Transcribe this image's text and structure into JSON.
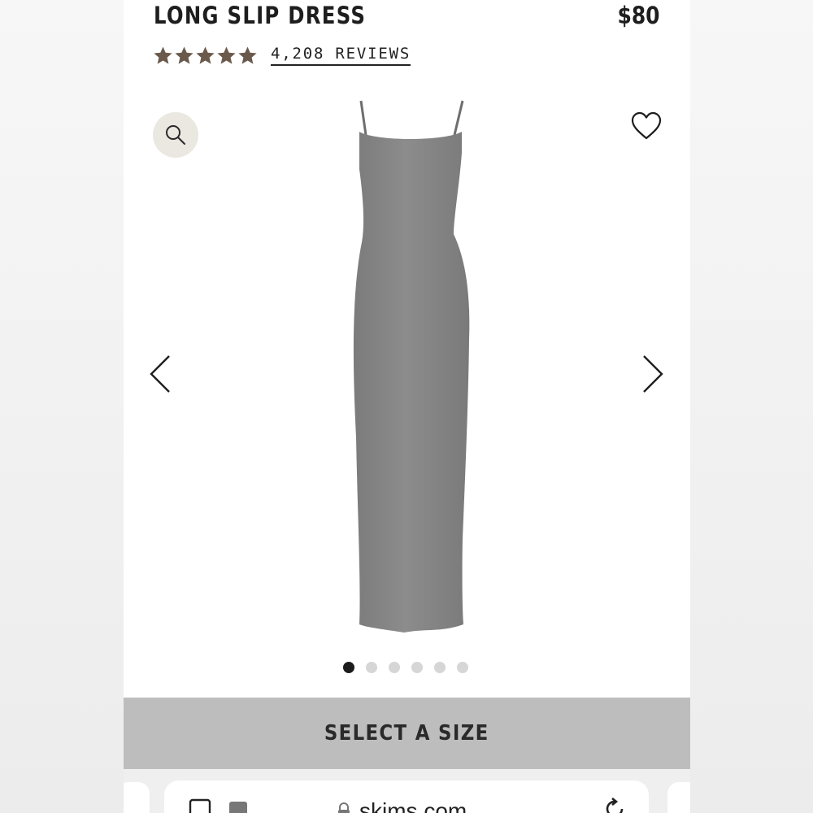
{
  "product": {
    "title": "LONG SLIP DRESS",
    "price": "$80",
    "rating": 5,
    "reviews_label": "4,208 REVIEWS",
    "image_count": 6,
    "active_image_index": 1
  },
  "cta": {
    "select_size_label": "SELECT A SIZE"
  },
  "browser": {
    "url": "skims.com"
  },
  "icons": {
    "zoom": "magnifier-icon",
    "wishlist": "heart-outline-icon",
    "prev": "chevron-left-icon",
    "next": "chevron-right-icon",
    "star": "star-icon",
    "lock": "lock-icon",
    "reader": "reader-icon",
    "tabs": "tabs-icon",
    "reload": "reload-icon"
  },
  "colors": {
    "star": "#6b5a4c",
    "text": "#1e1e1e",
    "cta_bg": "#bdbdbd",
    "zoom_bg": "#ebe7e1",
    "dress": "#858585",
    "dot_active": "#1c1c1c",
    "dot_inactive": "#d6d6d6"
  }
}
